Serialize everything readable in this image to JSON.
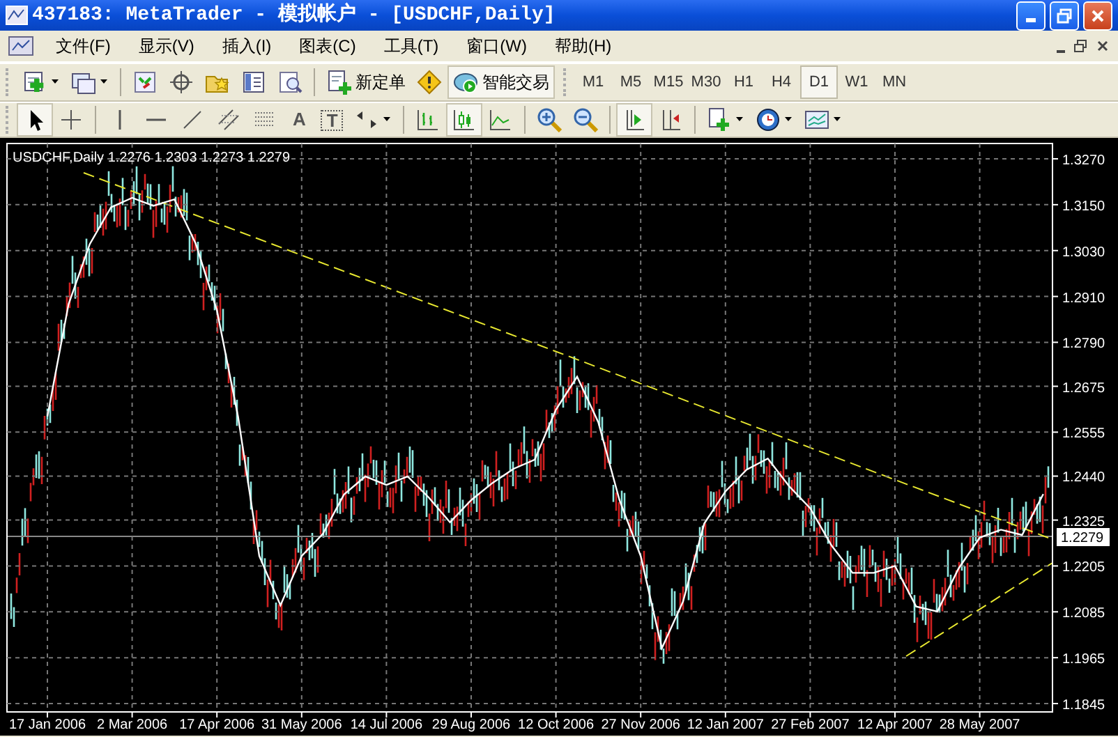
{
  "window": {
    "title": "437183: MetaTrader - 模拟帐户 - [USDCHF,Daily]"
  },
  "menu": [
    "文件(F)",
    "显示(V)",
    "插入(I)",
    "图表(C)",
    "工具(T)",
    "窗口(W)",
    "帮助(H)"
  ],
  "toolbar": [
    {
      "kind": "new-chart"
    },
    {
      "kind": "profiles"
    },
    {
      "kind": "sep"
    },
    {
      "kind": "market"
    },
    {
      "kind": "crosshair"
    },
    {
      "kind": "favorites"
    },
    {
      "kind": "navigator"
    },
    {
      "kind": "tester"
    },
    {
      "kind": "sep"
    },
    {
      "kind": "order",
      "label": "新定单"
    },
    {
      "kind": "warning"
    },
    {
      "kind": "experts",
      "label": "智能交易",
      "on": true
    }
  ],
  "timeframes": [
    {
      "label": "M1",
      "selected": false
    },
    {
      "label": "M5",
      "selected": false
    },
    {
      "label": "M15",
      "selected": false
    },
    {
      "label": "M30",
      "selected": false
    },
    {
      "label": "H1",
      "selected": false
    },
    {
      "label": "H4",
      "selected": false
    },
    {
      "label": "D1",
      "selected": true
    },
    {
      "label": "W1",
      "selected": false
    },
    {
      "label": "MN",
      "selected": false
    }
  ],
  "tools": [
    {
      "kind": "cursor",
      "selected": true
    },
    {
      "kind": "cross",
      "selected": false
    },
    {
      "kind": "sep"
    },
    {
      "kind": "vline",
      "selected": false
    },
    {
      "kind": "hline",
      "selected": false
    },
    {
      "kind": "trend",
      "selected": false
    },
    {
      "kind": "channel",
      "selected": false
    },
    {
      "kind": "fibo",
      "selected": false
    },
    {
      "kind": "text",
      "label": "A",
      "selected": false
    },
    {
      "kind": "label",
      "label": "T",
      "selected": false
    },
    {
      "kind": "arrows",
      "selected": false
    },
    {
      "kind": "sep"
    },
    {
      "kind": "bars",
      "selected": false
    },
    {
      "kind": "candles",
      "selected": true
    },
    {
      "kind": "line",
      "selected": false
    },
    {
      "kind": "sep"
    },
    {
      "kind": "zoomin",
      "selected": false
    },
    {
      "kind": "zoomout",
      "selected": false
    },
    {
      "kind": "sep"
    },
    {
      "kind": "autoscroll",
      "selected": true
    },
    {
      "kind": "shift",
      "selected": false
    },
    {
      "kind": "sep"
    },
    {
      "kind": "indicators",
      "selected": false
    },
    {
      "kind": "periods",
      "selected": false
    },
    {
      "kind": "templates",
      "selected": false
    }
  ],
  "chart": {
    "header": "USDCHF,Daily  1.2276 1.2303 1.2273 1.2279",
    "price_label": "1.2279",
    "chart_data": {
      "type": "line",
      "grid": true,
      "ylim": [
        1.1845,
        1.327
      ],
      "yticks": [
        {
          "value": 1.327,
          "label": "1.3270"
        },
        {
          "value": 1.315,
          "label": "1.3150"
        },
        {
          "value": 1.303,
          "label": "1.3030"
        },
        {
          "value": 1.291,
          "label": "1.2910"
        },
        {
          "value": 1.279,
          "label": "1.2790"
        },
        {
          "value": 1.2675,
          "label": "1.2675"
        },
        {
          "value": 1.2555,
          "label": "1.2555"
        },
        {
          "value": 1.244,
          "label": "1.2440"
        },
        {
          "value": 1.2325,
          "label": "1.2325"
        },
        {
          "value": 1.2205,
          "label": "1.2205"
        },
        {
          "value": 1.2085,
          "label": "1.2085"
        },
        {
          "value": 1.1965,
          "label": "1.1965"
        },
        {
          "value": 1.1845,
          "label": "1.1845"
        }
      ],
      "categories": [
        "17 Jan 2006",
        null,
        null,
        null,
        "2 Mar 2006",
        null,
        null,
        null,
        "17 Apr 2006",
        null,
        null,
        null,
        "31 May 2006",
        null,
        null,
        null,
        "14 Jul 2006",
        null,
        null,
        null,
        "29 Aug 2006",
        null,
        null,
        null,
        "12 Oct 2006",
        null,
        null,
        null,
        "27 Nov 2006",
        null,
        null,
        null,
        "12 Jan 2007",
        null,
        null,
        null,
        "27 Feb 2007",
        null,
        null,
        null,
        "12 Apr 2007",
        null,
        null,
        null,
        "28 May 2007",
        null,
        null,
        null
      ],
      "series": [
        {
          "color": "#ffffff",
          "values": [
            1.2596,
            1.289,
            1.3047,
            1.3143,
            1.3168,
            1.3147,
            1.3164,
            1.3048,
            1.2874,
            1.2595,
            1.2231,
            1.2102,
            1.2231,
            1.2289,
            1.2392,
            1.2439,
            1.2417,
            1.2439,
            1.2384,
            1.2319,
            1.2377,
            1.2422,
            1.2459,
            1.2483,
            1.2614,
            1.27,
            1.2581,
            1.2377,
            1.2231,
            1.199,
            1.2112,
            1.2316,
            1.24,
            1.2457,
            1.2486,
            1.2414,
            1.2356,
            1.2259,
            1.2187,
            1.2187,
            1.2205,
            1.2099,
            1.2086,
            1.2198,
            1.2279,
            1.23,
            1.2286,
            1.2393
          ]
        }
      ]
    }
  }
}
